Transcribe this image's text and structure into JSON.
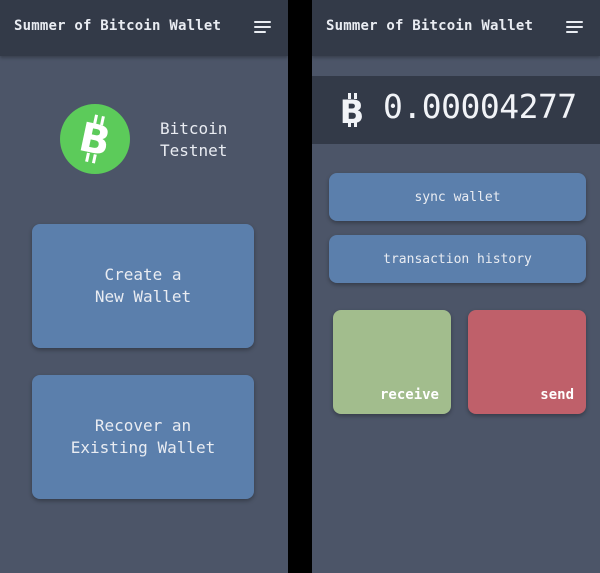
{
  "colors": {
    "background": "#4c5568",
    "appbar": "#333a48",
    "primary_button": "#5b7fac",
    "receive": "#a2bd8d",
    "send": "#bf606a",
    "bitcoin_logo": "#5ccb5a"
  },
  "left_screen": {
    "appbar": {
      "title": "Summer of Bitcoin Wallet",
      "menu_icon": "hamburger-menu-icon"
    },
    "logo_icon": "bitcoin-logo-icon",
    "network_label": "Bitcoin\nTestnet",
    "create_wallet_label": "Create a\nNew Wallet",
    "recover_wallet_label": "Recover an\nExisting Wallet"
  },
  "right_screen": {
    "appbar": {
      "title": "Summer of Bitcoin Wallet",
      "menu_icon": "hamburger-menu-icon"
    },
    "balance": {
      "symbol_icon": "bitcoin-symbol-icon",
      "amount": "0.00004277"
    },
    "sync_label": "sync wallet",
    "history_label": "transaction history",
    "receive_label": "receive",
    "send_label": "send"
  }
}
